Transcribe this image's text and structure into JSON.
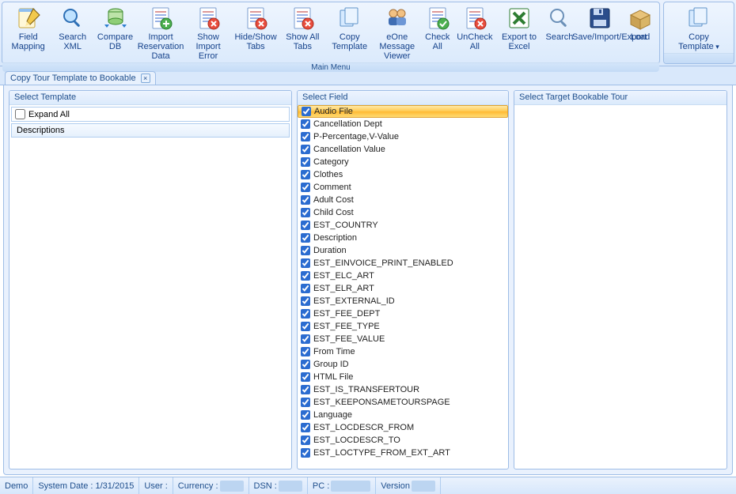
{
  "ribbon": {
    "mainGroupLabel": "Main Menu",
    "buttons": [
      {
        "id": "field-mapping",
        "label": "Field Mapping",
        "icon": "notebook-pencil"
      },
      {
        "id": "search-xml",
        "label": "Search XML",
        "icon": "magnifier-blue"
      },
      {
        "id": "compare-db",
        "label": "Compare DB",
        "icon": "db-arrows"
      },
      {
        "id": "import-reservation",
        "label": "Import Reservation Data",
        "icon": "sheet-plus"
      },
      {
        "id": "show-import-error",
        "label": "Show Import Error",
        "icon": "sheet-x-red"
      },
      {
        "id": "hide-show-tabs",
        "label": "Hide/Show Tabs",
        "icon": "sheet-x-red"
      },
      {
        "id": "show-all-tabs",
        "label": "Show All Tabs",
        "icon": "sheet-x-red"
      },
      {
        "id": "copy-template",
        "label": "Copy Template",
        "icon": "pages"
      },
      {
        "id": "eone-msg",
        "label": "eOne Message Viewer",
        "icon": "people"
      },
      {
        "id": "check-all",
        "label": "Check All",
        "icon": "sheet-check"
      },
      {
        "id": "uncheck-all",
        "label": "UnCheck All",
        "icon": "sheet-x-red"
      },
      {
        "id": "export-excel",
        "label": "Export to Excel",
        "icon": "excel"
      },
      {
        "id": "search",
        "label": "Search",
        "icon": "magnifier-plain"
      },
      {
        "id": "save-import-export",
        "label": "Save/Import/Export",
        "icon": "floppy"
      },
      {
        "id": "load",
        "label": "Load",
        "icon": "box-open"
      }
    ],
    "sideButton": {
      "label": "Copy Template"
    }
  },
  "tabs": {
    "active": "Copy Tour Template to Bookable"
  },
  "panels": {
    "left": {
      "title": "Select Template",
      "expandAll": {
        "label": "Expand All",
        "checked": false
      },
      "descriptions": "Descriptions"
    },
    "mid": {
      "title": "Select Field",
      "fields": [
        {
          "label": "Audio File",
          "checked": true,
          "selected": true
        },
        {
          "label": "Cancellation Dept",
          "checked": true
        },
        {
          "label": "P-Percentage,V-Value",
          "checked": true
        },
        {
          "label": "Cancellation Value",
          "checked": true
        },
        {
          "label": "Category",
          "checked": true
        },
        {
          "label": "Clothes",
          "checked": true
        },
        {
          "label": "Comment",
          "checked": true
        },
        {
          "label": "Adult Cost",
          "checked": true
        },
        {
          "label": "Child Cost",
          "checked": true
        },
        {
          "label": "EST_COUNTRY",
          "checked": true
        },
        {
          "label": "Description",
          "checked": true
        },
        {
          "label": "Duration",
          "checked": true
        },
        {
          "label": "EST_EINVOICE_PRINT_ENABLED",
          "checked": true
        },
        {
          "label": "EST_ELC_ART",
          "checked": true
        },
        {
          "label": "EST_ELR_ART",
          "checked": true
        },
        {
          "label": "EST_EXTERNAL_ID",
          "checked": true
        },
        {
          "label": "EST_FEE_DEPT",
          "checked": true
        },
        {
          "label": "EST_FEE_TYPE",
          "checked": true
        },
        {
          "label": "EST_FEE_VALUE",
          "checked": true
        },
        {
          "label": "From Time",
          "checked": true
        },
        {
          "label": "Group ID",
          "checked": true
        },
        {
          "label": "HTML File",
          "checked": true
        },
        {
          "label": "EST_IS_TRANSFERTOUR",
          "checked": true
        },
        {
          "label": "EST_KEEPONSAMETOURSPAGE",
          "checked": true
        },
        {
          "label": "Language",
          "checked": true
        },
        {
          "label": "EST_LOCDESCR_FROM",
          "checked": true
        },
        {
          "label": "EST_LOCDESCR_TO",
          "checked": true
        },
        {
          "label": "EST_LOCTYPE_FROM_EXT_ART",
          "checked": true
        }
      ]
    },
    "right": {
      "title": "Select Target Bookable Tour"
    }
  },
  "status": {
    "demo": "Demo",
    "systemDateLabel": "System Date :",
    "systemDate": "1/31/2015",
    "userLabel": "User :",
    "currencyLabel": "Currency :",
    "dsnLabel": "DSN :",
    "pcLabel": "PC :",
    "versionLabel": "Version"
  }
}
